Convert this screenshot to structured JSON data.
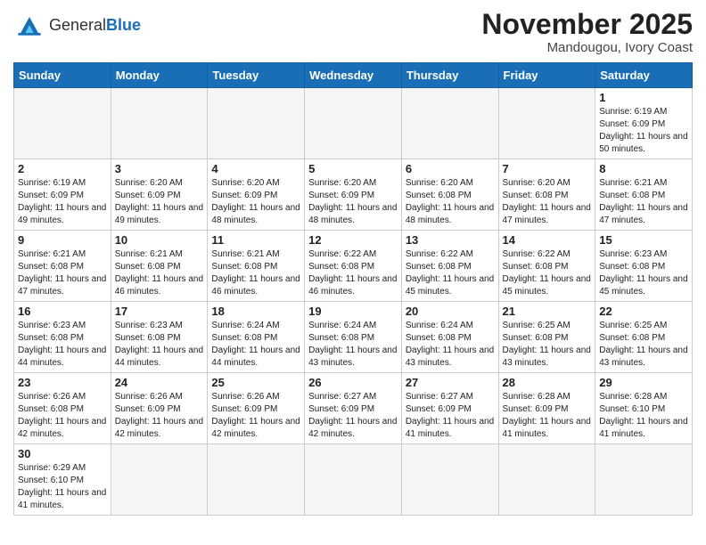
{
  "header": {
    "logo_general": "General",
    "logo_blue": "Blue",
    "month_year": "November 2025",
    "location": "Mandougou, Ivory Coast"
  },
  "days_of_week": [
    "Sunday",
    "Monday",
    "Tuesday",
    "Wednesday",
    "Thursday",
    "Friday",
    "Saturday"
  ],
  "weeks": [
    [
      {
        "day": null,
        "empty": true
      },
      {
        "day": null,
        "empty": true
      },
      {
        "day": null,
        "empty": true
      },
      {
        "day": null,
        "empty": true
      },
      {
        "day": null,
        "empty": true
      },
      {
        "day": null,
        "empty": true
      },
      {
        "day": 1,
        "sunrise": "6:19 AM",
        "sunset": "6:09 PM",
        "daylight": "11 hours and 50 minutes."
      }
    ],
    [
      {
        "day": 2,
        "sunrise": "6:19 AM",
        "sunset": "6:09 PM",
        "daylight": "11 hours and 49 minutes."
      },
      {
        "day": 3,
        "sunrise": "6:20 AM",
        "sunset": "6:09 PM",
        "daylight": "11 hours and 49 minutes."
      },
      {
        "day": 4,
        "sunrise": "6:20 AM",
        "sunset": "6:09 PM",
        "daylight": "11 hours and 48 minutes."
      },
      {
        "day": 5,
        "sunrise": "6:20 AM",
        "sunset": "6:09 PM",
        "daylight": "11 hours and 48 minutes."
      },
      {
        "day": 6,
        "sunrise": "6:20 AM",
        "sunset": "6:08 PM",
        "daylight": "11 hours and 48 minutes."
      },
      {
        "day": 7,
        "sunrise": "6:20 AM",
        "sunset": "6:08 PM",
        "daylight": "11 hours and 47 minutes."
      },
      {
        "day": 8,
        "sunrise": "6:21 AM",
        "sunset": "6:08 PM",
        "daylight": "11 hours and 47 minutes."
      }
    ],
    [
      {
        "day": 9,
        "sunrise": "6:21 AM",
        "sunset": "6:08 PM",
        "daylight": "11 hours and 47 minutes."
      },
      {
        "day": 10,
        "sunrise": "6:21 AM",
        "sunset": "6:08 PM",
        "daylight": "11 hours and 46 minutes."
      },
      {
        "day": 11,
        "sunrise": "6:21 AM",
        "sunset": "6:08 PM",
        "daylight": "11 hours and 46 minutes."
      },
      {
        "day": 12,
        "sunrise": "6:22 AM",
        "sunset": "6:08 PM",
        "daylight": "11 hours and 46 minutes."
      },
      {
        "day": 13,
        "sunrise": "6:22 AM",
        "sunset": "6:08 PM",
        "daylight": "11 hours and 45 minutes."
      },
      {
        "day": 14,
        "sunrise": "6:22 AM",
        "sunset": "6:08 PM",
        "daylight": "11 hours and 45 minutes."
      },
      {
        "day": 15,
        "sunrise": "6:23 AM",
        "sunset": "6:08 PM",
        "daylight": "11 hours and 45 minutes."
      }
    ],
    [
      {
        "day": 16,
        "sunrise": "6:23 AM",
        "sunset": "6:08 PM",
        "daylight": "11 hours and 44 minutes."
      },
      {
        "day": 17,
        "sunrise": "6:23 AM",
        "sunset": "6:08 PM",
        "daylight": "11 hours and 44 minutes."
      },
      {
        "day": 18,
        "sunrise": "6:24 AM",
        "sunset": "6:08 PM",
        "daylight": "11 hours and 44 minutes."
      },
      {
        "day": 19,
        "sunrise": "6:24 AM",
        "sunset": "6:08 PM",
        "daylight": "11 hours and 43 minutes."
      },
      {
        "day": 20,
        "sunrise": "6:24 AM",
        "sunset": "6:08 PM",
        "daylight": "11 hours and 43 minutes."
      },
      {
        "day": 21,
        "sunrise": "6:25 AM",
        "sunset": "6:08 PM",
        "daylight": "11 hours and 43 minutes."
      },
      {
        "day": 22,
        "sunrise": "6:25 AM",
        "sunset": "6:08 PM",
        "daylight": "11 hours and 43 minutes."
      }
    ],
    [
      {
        "day": 23,
        "sunrise": "6:26 AM",
        "sunset": "6:08 PM",
        "daylight": "11 hours and 42 minutes."
      },
      {
        "day": 24,
        "sunrise": "6:26 AM",
        "sunset": "6:09 PM",
        "daylight": "11 hours and 42 minutes."
      },
      {
        "day": 25,
        "sunrise": "6:26 AM",
        "sunset": "6:09 PM",
        "daylight": "11 hours and 42 minutes."
      },
      {
        "day": 26,
        "sunrise": "6:27 AM",
        "sunset": "6:09 PM",
        "daylight": "11 hours and 42 minutes."
      },
      {
        "day": 27,
        "sunrise": "6:27 AM",
        "sunset": "6:09 PM",
        "daylight": "11 hours and 41 minutes."
      },
      {
        "day": 28,
        "sunrise": "6:28 AM",
        "sunset": "6:09 PM",
        "daylight": "11 hours and 41 minutes."
      },
      {
        "day": 29,
        "sunrise": "6:28 AM",
        "sunset": "6:10 PM",
        "daylight": "11 hours and 41 minutes."
      }
    ],
    [
      {
        "day": 30,
        "sunrise": "6:29 AM",
        "sunset": "6:10 PM",
        "daylight": "11 hours and 41 minutes."
      },
      {
        "day": null,
        "empty": true
      },
      {
        "day": null,
        "empty": true
      },
      {
        "day": null,
        "empty": true
      },
      {
        "day": null,
        "empty": true
      },
      {
        "day": null,
        "empty": true
      },
      {
        "day": null,
        "empty": true
      }
    ]
  ],
  "labels": {
    "sunrise": "Sunrise:",
    "sunset": "Sunset:",
    "daylight": "Daylight:"
  }
}
